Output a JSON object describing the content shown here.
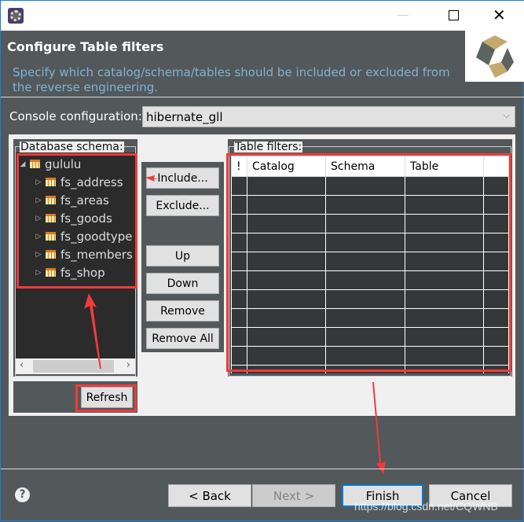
{
  "window": {
    "icon": "eclipse-gear-icon",
    "controls": [
      "minimize",
      "maximize",
      "close"
    ]
  },
  "header": {
    "title": "Configure Table filters",
    "description": "Specify which catalog/schema/tables should be included or excluded from the reverse engineering.",
    "logo": "hibernate-logo"
  },
  "console": {
    "label": "Console configuration:",
    "value": "hibernate_gll"
  },
  "schema": {
    "label": "Database schema:",
    "root": "gululu",
    "items": [
      "fs_address",
      "fs_areas",
      "fs_goods",
      "fs_goodtype",
      "fs_members",
      "fs_shop"
    ],
    "refresh": "Refresh"
  },
  "actions": {
    "include": "Include...",
    "exclude": "Exclude...",
    "up": "Up",
    "down": "Down",
    "remove": "Remove",
    "remove_all": "Remove All"
  },
  "filters": {
    "label": "Table filters:",
    "columns": [
      "!",
      "Catalog",
      "Schema",
      "Table",
      ""
    ],
    "rows": []
  },
  "footer": {
    "back": "< Back",
    "next": "Next >",
    "finish": "Finish",
    "cancel": "Cancel",
    "watermark": "https://blog.csdn.net/CQWNB"
  },
  "colors": {
    "header_bg": "#53585b",
    "accent_text": "#7fb2d4",
    "highlight": "#ef3b3b",
    "focus": "#0078d7"
  }
}
